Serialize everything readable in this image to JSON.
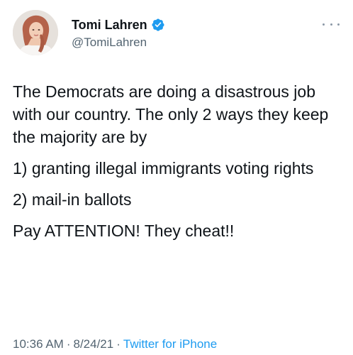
{
  "author": {
    "display_name": "Tomi Lahren",
    "handle": "@TomiLahren",
    "verified_icon": "verified-badge-icon",
    "avatar_icon": "profile-photo"
  },
  "more_icon": "more-options-icon",
  "tweet": {
    "paragraphs": [
      "The Democrats are doing a disastrous job with our country. The only 2 ways they keep the majority are by",
      "1) granting illegal immigrants voting rights",
      "2) mail-in ballots",
      "Pay ATTENTION! They cheat!!"
    ]
  },
  "meta": {
    "time": "10:36 AM",
    "separator": "·",
    "date": "8/24/21",
    "source": "Twitter for iPhone"
  },
  "colors": {
    "text": "#0f1419",
    "secondary": "#536471",
    "accent": "#1d9bf0"
  }
}
